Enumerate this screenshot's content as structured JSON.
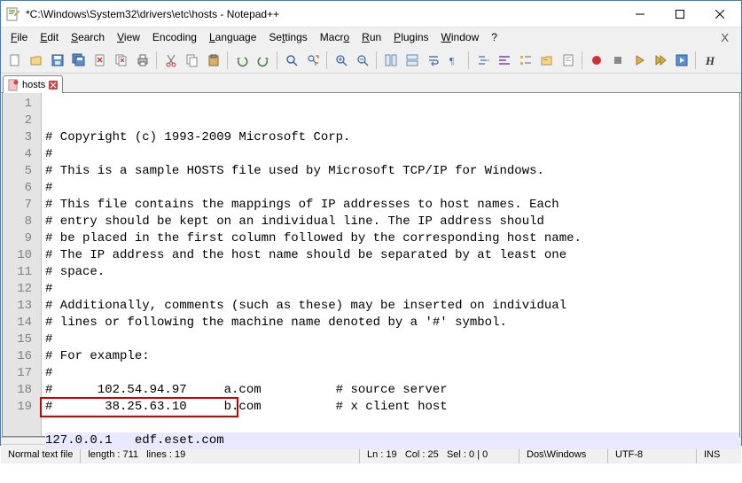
{
  "window": {
    "title": "*C:\\Windows\\System32\\drivers\\etc\\hosts - Notepad++"
  },
  "menu": {
    "file": "File",
    "edit": "Edit",
    "search": "Search",
    "view": "View",
    "encoding": "Encoding",
    "language": "Language",
    "settings": "Settings",
    "macro": "Macro",
    "run": "Run",
    "plugins": "Plugins",
    "window": "Window",
    "help": "?"
  },
  "tab": {
    "label": "hosts"
  },
  "lines": [
    "# Copyright (c) 1993-2009 Microsoft Corp.",
    "#",
    "# This is a sample HOSTS file used by Microsoft TCP/IP for Windows.",
    "#",
    "# This file contains the mappings of IP addresses to host names. Each",
    "# entry should be kept on an individual line. The IP address should",
    "# be placed in the first column followed by the corresponding host name.",
    "# The IP address and the host name should be separated by at least one",
    "# space.",
    "#",
    "# Additionally, comments (such as these) may be inserted on individual",
    "# lines or following the machine name denoted by a '#' symbol.",
    "#",
    "# For example:",
    "#",
    "#      102.54.94.97     a.com          # source server",
    "#       38.25.63.10     b.com          # x client host",
    "",
    "127.0.0.1   edf.eset.com"
  ],
  "status": {
    "filetype": "Normal text file",
    "length_label": "length :",
    "length_val": "711",
    "lines_label": "lines :",
    "lines_val": "19",
    "ln_label": "Ln :",
    "ln_val": "19",
    "col_label": "Col :",
    "col_val": "25",
    "sel_label": "Sel :",
    "sel_val": "0 | 0",
    "eol": "Dos\\Windows",
    "encoding": "UTF-8",
    "ovr": "INS"
  }
}
